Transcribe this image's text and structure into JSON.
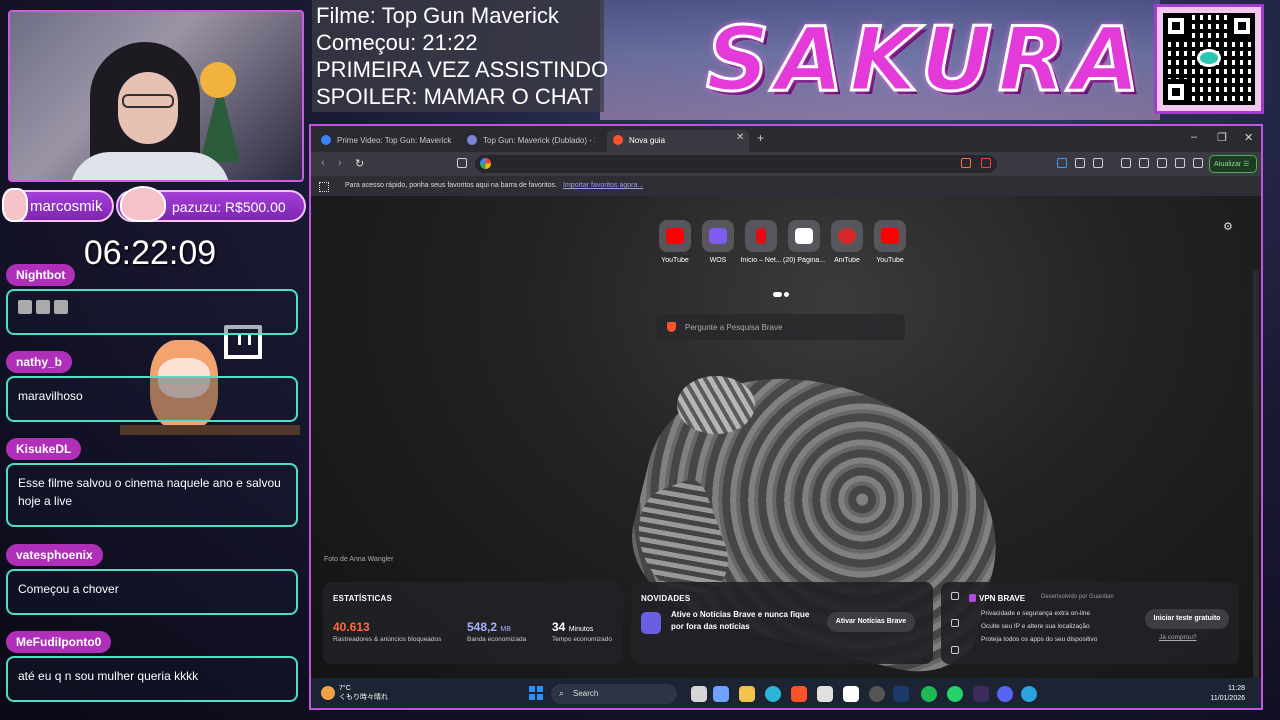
{
  "overlay": {
    "movie_lines": [
      "Filme: Top Gun Maverick",
      "Começou: 21:22",
      "PRIMEIRA VEZ ASSISTINDO",
      "SPOILER: MAMAR O CHAT"
    ],
    "logo_text": "SAKURA",
    "timer": "06:22:09",
    "alert_name": "marcosmik",
    "alert_donation": "pazuzu: R$500.00"
  },
  "chat": [
    {
      "user": "Nightbot",
      "message": "",
      "emotes": 3
    },
    {
      "user": "nathy_b",
      "message": "maravilhoso"
    },
    {
      "user": "KisukeDL",
      "message": "Esse filme salvou o cinema naquele ano e salvou hoje a live"
    },
    {
      "user": "vatesphoenix",
      "message": "Começou a chover"
    },
    {
      "user": "MeFudiIponto0",
      "message": "até eu q n sou mulher queria kkkk"
    }
  ],
  "browser": {
    "tabs": [
      {
        "title": "Prime Video: Top Gun: Maverick",
        "active": false,
        "icon_color": "#3b82f6"
      },
      {
        "title": "Top Gun: Maverick (Dublado) - 2",
        "active": false,
        "icon_color": "#7c85d8"
      },
      {
        "title": "Nova guia",
        "active": true,
        "icon_color": "#fb542b"
      }
    ],
    "address_value": "",
    "update_label": "Atualizar",
    "bookmarks_text": "Para acesso rápido, ponha seus favoritos aqui na barra de favoritos.",
    "bookmarks_link": "Importar favoritos agora...",
    "shortcuts": [
      {
        "label": "YouTube",
        "color": "#ff0000",
        "icon": "youtube-icon"
      },
      {
        "label": "WOS",
        "color": "#7f5af0",
        "icon": "wos-icon"
      },
      {
        "label": "Início – Net...",
        "color": "#e50914",
        "icon": "netflix-icon"
      },
      {
        "label": "(20) Página...",
        "color": "#ffffff",
        "icon": "x-icon"
      },
      {
        "label": "AniTube",
        "color": "#d62828",
        "icon": "anitube-icon"
      },
      {
        "label": "YouTube",
        "color": "#ff0000",
        "icon": "youtube-icon"
      }
    ],
    "search_placeholder": "Pergunte a Pesquisa Brave",
    "photo_credit": "Foto de Anna Wangler",
    "stats": {
      "title": "ESTATÍSTICAS",
      "trackers_value": "40.613",
      "trackers_label": "Rastreadores & anúncios bloqueados",
      "bandwidth_value": "548,2",
      "bandwidth_unit": "MB",
      "bandwidth_label": "Banda economizada",
      "time_value": "34",
      "time_unit": "Minutos",
      "time_label": "Tempo economizado",
      "trackers_color": "#ff6a3d"
    },
    "news": {
      "title": "NOVIDADES",
      "text": "Ative o Notícias Brave e nunca fique por fora das notícias",
      "button": "Ativar Notícias Brave"
    },
    "vpn": {
      "title": "VPN BRAVE",
      "developer": "Desenvolvido por Guardian",
      "lines": [
        "Privacidade e segurança extra on-line",
        "Oculte seu IP e altere sua localização",
        "Proteja todos os apps do seu dispositivo"
      ],
      "button": "Iniciar teste gratuito",
      "link": "Já comprou?"
    }
  },
  "taskbar": {
    "weather_temp": "7°C",
    "weather_desc": "くもり時々晴れ",
    "search_label": "Search",
    "time": "11:28",
    "date": "11/01/2026"
  }
}
